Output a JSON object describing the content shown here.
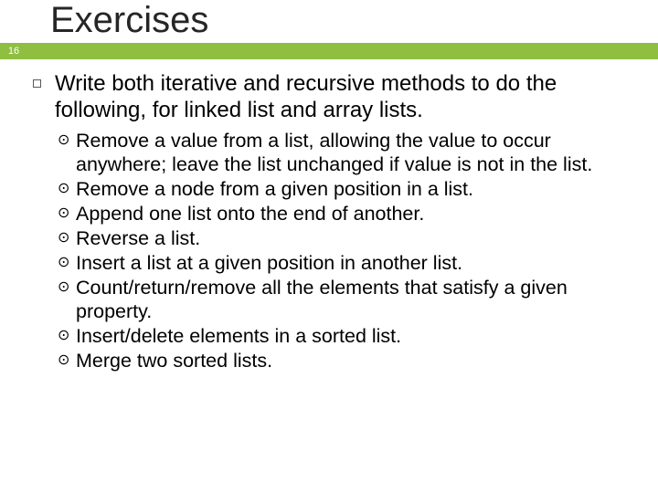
{
  "page_number": "16",
  "title": "Exercises",
  "bullet_glyph": "⊙",
  "intro": "Write both iterative and recursive methods to do the following, for linked list and array lists.",
  "items": [
    "Remove a value from a list, allowing the value to occur anywhere; leave the list unchanged if value is not in the list.",
    "Remove a node from a given position in a list.",
    "Append one list onto the end of another.",
    "Reverse a list.",
    "Insert a list at a given position in another list.",
    "Count/return/remove all the elements that satisfy a given property.",
    "Insert/delete elements in a sorted list.",
    "Merge two sorted lists."
  ],
  "colors": {
    "accent": "#8fbe41",
    "text": "#000000",
    "title": "#262626"
  }
}
